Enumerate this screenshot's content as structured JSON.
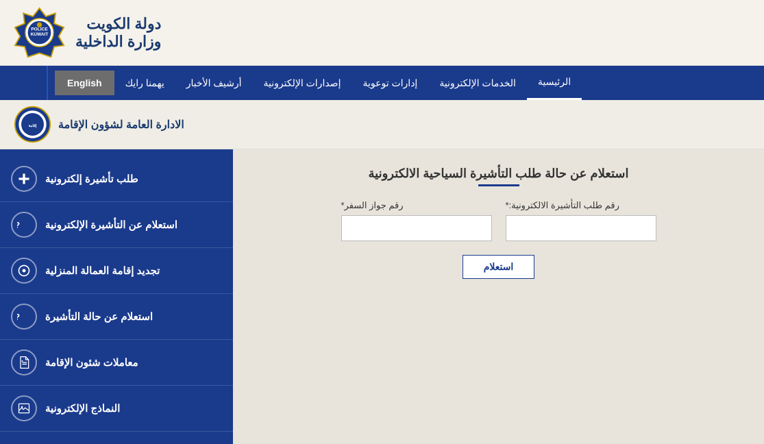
{
  "header": {
    "title1": "دولة الكويت",
    "title2": "وزارة الداخلية"
  },
  "navbar": {
    "items": [
      {
        "label": "الرئيسية",
        "active": true
      },
      {
        "label": "الخدمات الإلكترونية"
      },
      {
        "label": "إدارات توعوية"
      },
      {
        "label": "إصدارات الإلكترونية"
      },
      {
        "label": "أرشيف الأخبار"
      },
      {
        "label": "يهمنا رايك"
      }
    ],
    "english_label": "English"
  },
  "sub_header": {
    "title": "الادارة العامة لشؤون الإقامة"
  },
  "form": {
    "title": "استعلام عن حالة طلب التأشيرة السياحية الالكترونية",
    "field1_label": "رقم طلب التأشيرة الالكترونية:*",
    "field2_label": "رقم جواز السفر*",
    "field1_placeholder": "",
    "field2_placeholder": "",
    "submit_label": "استعلام"
  },
  "sidebar": {
    "items": [
      {
        "label": "طلب تأشيرة إلكترونية",
        "icon": "plus"
      },
      {
        "label": "استعلام عن التأشيرة الإلكترونية",
        "icon": "question"
      },
      {
        "label": "تجديد إقامة العمالة المنزلية",
        "icon": "settings"
      },
      {
        "label": "استعلام عن حالة التأشيرة",
        "icon": "question"
      },
      {
        "label": "معاملات شئون الإقامة",
        "icon": "document"
      },
      {
        "label": "النماذج الإلكترونية",
        "icon": "image"
      }
    ]
  }
}
